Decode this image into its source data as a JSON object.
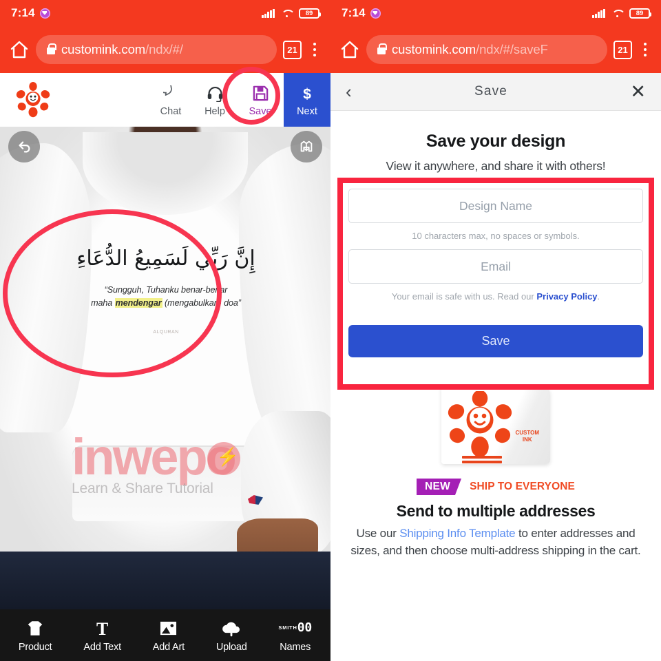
{
  "status_bar": {
    "time": "7:14",
    "battery": "89",
    "app_icon": "heart-app-icon"
  },
  "left": {
    "browser": {
      "url_domain": "customink.com",
      "url_path": "/ndx/#/",
      "tab_count": "21"
    },
    "toolbar": {
      "chat": "Chat",
      "help": "Help",
      "save": "Save",
      "next": "Next",
      "brand": "customink-octopus-logo"
    },
    "canvas": {
      "undo": "undo-icon",
      "flip": "flip-product-icon",
      "design": {
        "arabic": "إِنَّ رَبِّي لَسَمِيعُ الدُّعَاءِ",
        "translation_line1": "“Sungguh, Tuhanku benar-benar",
        "translation_line2_pre": "maha ",
        "translation_highlight": "mendengar",
        "translation_line2_post": " (mengabulkan) doa”",
        "credit": "ALQURAN"
      },
      "watermark": {
        "main": "inwepo",
        "sub": "Learn & Share Tutorial"
      }
    },
    "bottom_tools": [
      {
        "label": "Product",
        "icon": "tshirt-icon"
      },
      {
        "label": "Add Text",
        "icon": "text-t-icon"
      },
      {
        "label": "Add Art",
        "icon": "image-icon"
      },
      {
        "label": "Upload",
        "icon": "cloud-upload-icon"
      },
      {
        "label": "Names",
        "icon": "names-number-icon",
        "smith": "SMITH",
        "number": "00"
      }
    ]
  },
  "right": {
    "browser": {
      "url_domain": "customink.com",
      "url_path": "/ndx/#/saveF",
      "tab_count": "21"
    },
    "modal": {
      "title": "Save",
      "back": "back-chevron-icon",
      "close": "close-icon",
      "heading": "Save your design",
      "subheading": "View it anywhere, and share it with others!",
      "design_name_placeholder": "Design Name",
      "design_name_value": "",
      "design_name_hint": "10 characters max, no spaces or symbols.",
      "email_placeholder": "Email",
      "email_value": "",
      "email_hint_pre": "Your email is safe with us. Read our ",
      "email_hint_link": "Privacy Policy",
      "email_hint_post": ".",
      "save_button": "Save"
    },
    "promo": {
      "box_label_1": "CUSTOM",
      "box_label_2": "INK",
      "new_badge": "NEW",
      "eyebrow": "SHIP TO EVERYONE",
      "heading": "Send to multiple addresses",
      "body_pre": "Use our ",
      "body_link": "Shipping Info Template",
      "body_post": " to enter addresses and sizes, and then choose multi-address shipping in the cart."
    }
  },
  "colors": {
    "browser_red": "#f4391f",
    "annotation_red": "#f73550",
    "save_purple": "#9b2fae",
    "next_blue": "#2b50cf",
    "brand_orange": "#e8451c",
    "new_badge_purple": "#a41fb5"
  }
}
